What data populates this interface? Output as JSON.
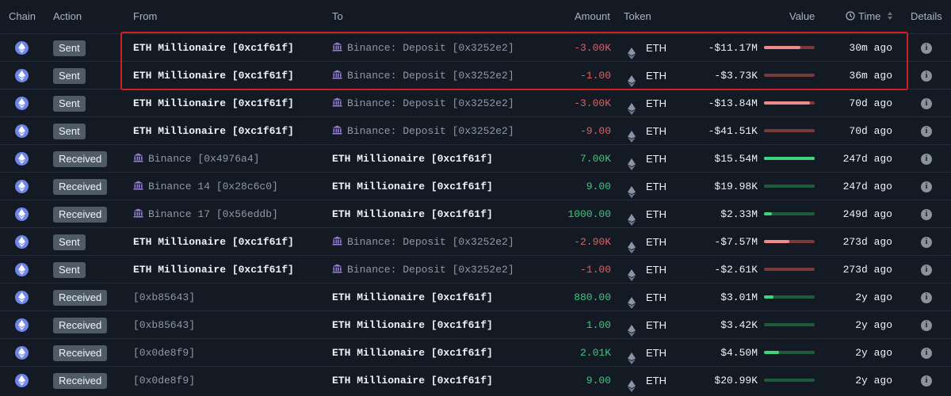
{
  "header": {
    "chain": "Chain",
    "action": "Action",
    "from": "From",
    "to": "To",
    "amount": "Amount",
    "token": "Token",
    "value": "Value",
    "time": "Time",
    "details": "Details",
    "time_icon": "clock-icon",
    "sort_icon": "sort-arrows-icon"
  },
  "colors": {
    "negative": "#e85d5d",
    "positive": "#3fc77b",
    "highlight": "#d41f1f",
    "chain": "#6f86e8"
  },
  "info_glyph": "i",
  "rows": [
    {
      "action": "Sent",
      "from": "ETH Millionaire [0xc1f61f]",
      "from_entity": false,
      "to": "Binance: Deposit [0x3252e2]",
      "to_entity": true,
      "amount": "-3.00K",
      "token": "ETH",
      "value": "-$11.17M",
      "fill": 0.72,
      "time": "30m ago"
    },
    {
      "action": "Sent",
      "from": "ETH Millionaire [0xc1f61f]",
      "from_entity": false,
      "to": "Binance: Deposit [0x3252e2]",
      "to_entity": true,
      "amount": "-1.00",
      "token": "ETH",
      "value": "-$3.73K",
      "fill": 0.0,
      "time": "36m ago"
    },
    {
      "action": "Sent",
      "from": "ETH Millionaire [0xc1f61f]",
      "from_entity": false,
      "to": "Binance: Deposit [0x3252e2]",
      "to_entity": true,
      "amount": "-3.00K",
      "token": "ETH",
      "value": "-$13.84M",
      "fill": 0.9,
      "time": "70d ago"
    },
    {
      "action": "Sent",
      "from": "ETH Millionaire [0xc1f61f]",
      "from_entity": false,
      "to": "Binance: Deposit [0x3252e2]",
      "to_entity": true,
      "amount": "-9.00",
      "token": "ETH",
      "value": "-$41.51K",
      "fill": 0.0,
      "time": "70d ago"
    },
    {
      "action": "Received",
      "from": "Binance [0x4976a4]",
      "from_entity": true,
      "to": "ETH Millionaire [0xc1f61f]",
      "to_entity": false,
      "amount": "7.00K",
      "token": "ETH",
      "value": "$15.54M",
      "fill": 1.0,
      "time": "247d ago"
    },
    {
      "action": "Received",
      "from": "Binance 14 [0x28c6c0]",
      "from_entity": true,
      "to": "ETH Millionaire [0xc1f61f]",
      "to_entity": false,
      "amount": "9.00",
      "token": "ETH",
      "value": "$19.98K",
      "fill": 0.0,
      "time": "247d ago"
    },
    {
      "action": "Received",
      "from": "Binance 17 [0x56eddb]",
      "from_entity": true,
      "to": "ETH Millionaire [0xc1f61f]",
      "to_entity": false,
      "amount": "1000.00",
      "token": "ETH",
      "value": "$2.33M",
      "fill": 0.15,
      "time": "249d ago"
    },
    {
      "action": "Sent",
      "from": "ETH Millionaire [0xc1f61f]",
      "from_entity": false,
      "to": "Binance: Deposit [0x3252e2]",
      "to_entity": true,
      "amount": "-2.90K",
      "token": "ETH",
      "value": "-$7.57M",
      "fill": 0.5,
      "time": "273d ago"
    },
    {
      "action": "Sent",
      "from": "ETH Millionaire [0xc1f61f]",
      "from_entity": false,
      "to": "Binance: Deposit [0x3252e2]",
      "to_entity": true,
      "amount": "-1.00",
      "token": "ETH",
      "value": "-$2.61K",
      "fill": 0.0,
      "time": "273d ago"
    },
    {
      "action": "Received",
      "from": "[0xb85643]",
      "from_entity": false,
      "to": "ETH Millionaire [0xc1f61f]",
      "to_entity": false,
      "amount": "880.00",
      "token": "ETH",
      "value": "$3.01M",
      "fill": 0.19,
      "time": "2y ago"
    },
    {
      "action": "Received",
      "from": "[0xb85643]",
      "from_entity": false,
      "to": "ETH Millionaire [0xc1f61f]",
      "to_entity": false,
      "amount": "1.00",
      "token": "ETH",
      "value": "$3.42K",
      "fill": 0.0,
      "time": "2y ago"
    },
    {
      "action": "Received",
      "from": "[0x0de8f9]",
      "from_entity": false,
      "to": "ETH Millionaire [0xc1f61f]",
      "to_entity": false,
      "amount": "2.01K",
      "token": "ETH",
      "value": "$4.50M",
      "fill": 0.29,
      "time": "2y ago"
    },
    {
      "action": "Received",
      "from": "[0x0de8f9]",
      "from_entity": false,
      "to": "ETH Millionaire [0xc1f61f]",
      "to_entity": false,
      "amount": "9.00",
      "token": "ETH",
      "value": "$20.99K",
      "fill": 0.0,
      "time": "2y ago"
    }
  ]
}
